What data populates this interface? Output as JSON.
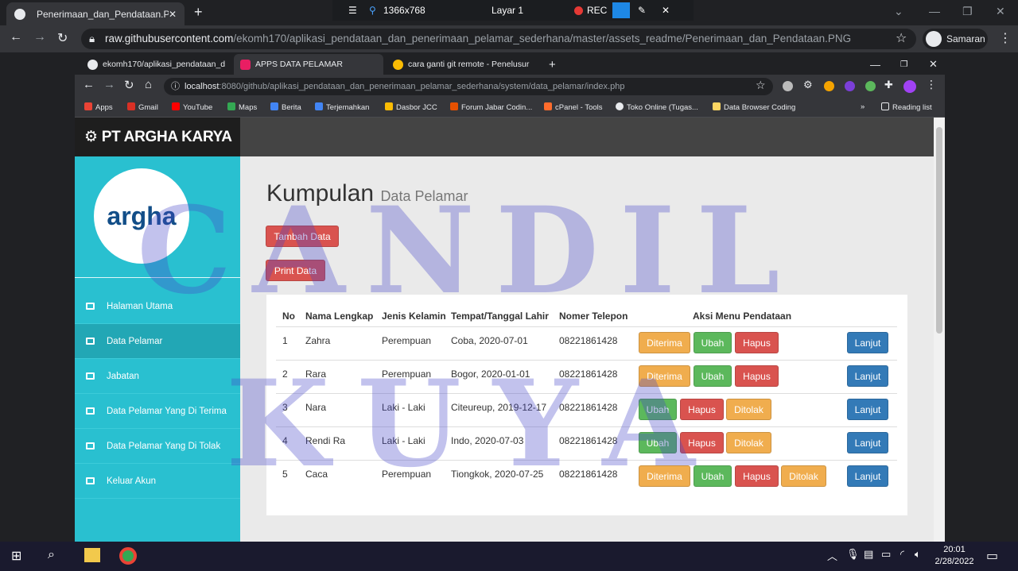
{
  "outer": {
    "tab_title": "Penerimaan_dan_Pendataan.PNG",
    "url_host": "raw.githubusercontent.com",
    "url_path": "/ekomh170/aplikasi_pendataan_dan_penerimaan_pelamar_sederhana/master/assets_readme/Penerimaan_dan_Pendataan.PNG",
    "profile": "Samaran"
  },
  "recorder": {
    "resolution": "1366x768",
    "layer": "Layar 1",
    "rec": "REC"
  },
  "inner": {
    "tabs": [
      "ekomh170/aplikasi_pendataan_d",
      "APPS DATA PELAMAR",
      "cara ganti git remote - Penelusur"
    ],
    "url_host": "localhost",
    "url_path": ":8080/github/aplikasi_pendataan_dan_penerimaan_pelamar_sederhana/system/data_pelamar/index.php",
    "bookmarks": [
      "Apps",
      "Gmail",
      "YouTube",
      "Maps",
      "Berita",
      "Terjemahkan",
      "Dasbor JCC",
      "Forum Jabar Codin...",
      "cPanel - Tools",
      "Toko Online (Tugas...",
      "Data Browser Coding",
      "Reading list"
    ]
  },
  "app": {
    "brand": "PT ARGHA KARYA",
    "logo_text": "argha",
    "menu": [
      "Halaman Utama",
      "Data Pelamar",
      "Jabatan",
      "Data Pelamar Yang Di Terima",
      "Data Pelamar Yang Di Tolak",
      "Keluar Akun"
    ],
    "title": "Kumpulan",
    "subtitle": "Data Pelamar",
    "btn_add": "Tambah Data",
    "btn_print": "Print Data",
    "columns": [
      "No",
      "Nama Lengkap",
      "Jenis Kelamin",
      "Tempat/Tanggal Lahir",
      "Nomer Telepon",
      "Aksi Menu Pendataan"
    ],
    "rows": [
      {
        "no": "1",
        "name": "Zahra",
        "gender": "Perempuan",
        "birth": "Coba, 2020-07-01",
        "phone": "08221861428",
        "actions": [
          "Diterima",
          "Ubah",
          "Hapus"
        ]
      },
      {
        "no": "2",
        "name": "Rara",
        "gender": "Perempuan",
        "birth": "Bogor, 2020-01-01",
        "phone": "08221861428",
        "actions": [
          "Diterima",
          "Ubah",
          "Hapus"
        ]
      },
      {
        "no": "3",
        "name": "Nara",
        "gender": "Laki - Laki",
        "birth": "Citeureup, 2019-12-17",
        "phone": "08221861428",
        "actions": [
          "Ubah",
          "Hapus",
          "Ditolak"
        ]
      },
      {
        "no": "4",
        "name": "Rendi Ra",
        "gender": "Laki - Laki",
        "birth": "Indo, 2020-07-03",
        "phone": "08221861428",
        "actions": [
          "Ubah",
          "Hapus",
          "Ditolak"
        ]
      },
      {
        "no": "5",
        "name": "Caca",
        "gender": "Perempuan",
        "birth": "Tiongkok, 2020-07-25",
        "phone": "08221861428",
        "actions": [
          "Diterima",
          "Ubah",
          "Hapus",
          "Ditolak"
        ]
      }
    ],
    "next_label": "Lanjut",
    "watermark": [
      "CANDIL",
      "KUYA"
    ]
  },
  "taskbar": {
    "time": "20:01",
    "date": "2/28/2022"
  },
  "colors": {
    "sidebar": "#29c0d0",
    "danger": "#d9534f",
    "success": "#5cb85c",
    "warning": "#f0ad4e",
    "primary": "#337ab7"
  }
}
